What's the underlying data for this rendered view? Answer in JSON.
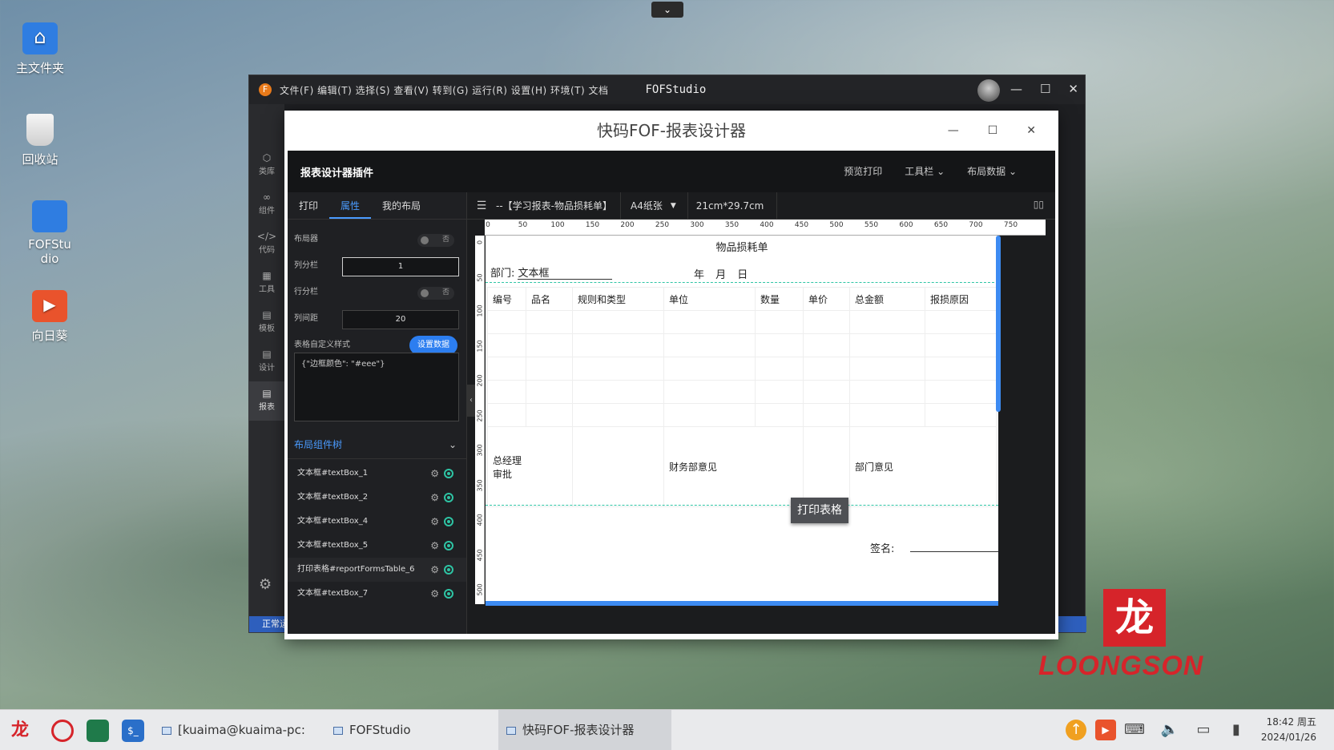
{
  "desktop": {
    "icons": [
      {
        "label": "主文件夹",
        "icon": "home-folder-icon"
      },
      {
        "label": "回收站",
        "icon": "trash-icon"
      },
      {
        "label": "FOFStudio",
        "icon": "folder-icon"
      },
      {
        "label": "向日葵",
        "icon": "sunflower-app-icon"
      }
    ],
    "top_chevron": "⌄"
  },
  "fofstudio": {
    "menu": "文件(F) 编辑(T) 选择(S) 查看(V) 转到(G) 运行(R) 设置(H) 环境(T) 文档",
    "title": "FOFStudio",
    "side_items": [
      {
        "label": "类库",
        "icon": "cube-icon"
      },
      {
        "label": "组件",
        "icon": "link-icon"
      },
      {
        "label": "代码",
        "icon": "code-icon"
      },
      {
        "label": "工具",
        "icon": "tools-icon"
      },
      {
        "label": "模板",
        "icon": "template-icon"
      },
      {
        "label": "设计",
        "icon": "design-icon"
      },
      {
        "label": "报表",
        "icon": "report-icon"
      }
    ],
    "status": "正常运"
  },
  "designer": {
    "title": "快码FOF-报表设计器",
    "plugin_title": "报表设计器插件",
    "actions": [
      "预览打印",
      "工具栏 ⌄",
      "布局数据 ⌄"
    ],
    "tabs": [
      "打印",
      "属性",
      "我的布局"
    ],
    "active_tab": "属性",
    "props": {
      "layout_label": "布局器",
      "layout_toggle": "否",
      "col_label": "列分栏",
      "col_value": "1",
      "row_label": "行分栏",
      "row_toggle": "否",
      "gap_label": "列间距",
      "gap_value": "20",
      "style_label": "表格自定义样式",
      "style_button": "设置数据",
      "style_json": "{\"边框颜色\": \"#eee\"}"
    },
    "tree": {
      "title": "布局组件树",
      "items": [
        "文本框#textBox_1",
        "文本框#textBox_2",
        "文本框#textBox_4",
        "文本框#textBox_5",
        "打印表格#reportFormsTable_6",
        "文本框#textBox_7"
      ]
    },
    "toolbar": {
      "doc": "--【学习报表-物品损耗单】",
      "paper": "A4纸张",
      "size": "21cm*29.7cm"
    },
    "ruler_h": [
      "0",
      "50",
      "100",
      "150",
      "200",
      "250",
      "300",
      "350",
      "400",
      "450",
      "500",
      "550",
      "600",
      "650",
      "700",
      "750"
    ],
    "ruler_v": [
      "0",
      "50",
      "100",
      "150",
      "200",
      "250",
      "300",
      "350",
      "400",
      "450",
      "500"
    ],
    "sheet": {
      "title": "物品损耗单",
      "dept": "部门: 文本框",
      "date": "年 月 日",
      "headers": [
        "编号",
        "品名",
        "规则和类型",
        "单位",
        "数量",
        "单价",
        "总金额",
        "报损原因"
      ],
      "approval": [
        "总经理\n审批",
        "财务部意见",
        "部门意见"
      ],
      "print_button": "打印表格",
      "sign": "签名:"
    }
  },
  "taskbar": {
    "tasks": [
      "[kuaima@kuaima-pc: ~···",
      "FOFStudio",
      "快码FOF-报表设计器"
    ],
    "time": "18:42 周五",
    "date": "2024/01/26"
  },
  "branding": {
    "logo_text": "LOONGSON",
    "logo_color": "#d6242a"
  }
}
